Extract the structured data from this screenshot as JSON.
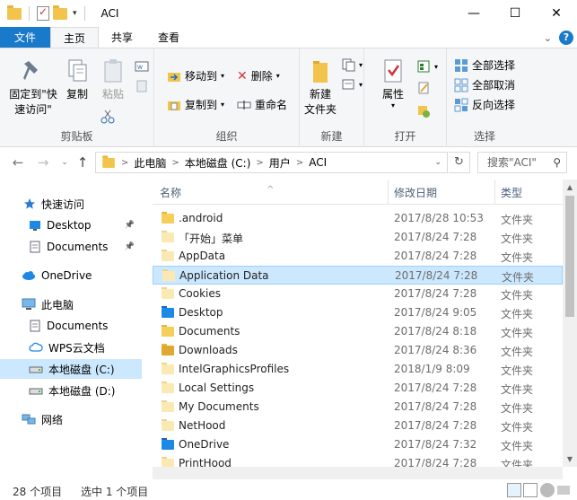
{
  "window": {
    "title": "ACI"
  },
  "ribbon_tabs": [
    "文件",
    "主页",
    "共享",
    "查看"
  ],
  "ribbon": {
    "clipboard": {
      "pin_label": "固定到\"快\n速访问\"",
      "copy_label": "复制",
      "paste_label": "粘贴",
      "group": "剪贴板"
    },
    "organize": {
      "move_to": "移动到",
      "copy_to": "复制到",
      "delete": "删除",
      "rename": "重命名",
      "group": "组织"
    },
    "new": {
      "new_folder": "新建\n文件夹",
      "group": "新建"
    },
    "open": {
      "properties": "属性",
      "group": "打开"
    },
    "select": {
      "select_all": "全部选择",
      "select_none": "全部取消",
      "invert": "反向选择",
      "group": "选择"
    }
  },
  "address": {
    "crumbs": [
      "此电脑",
      "本地磁盘 (C:)",
      "用户",
      "ACI"
    ],
    "search_placeholder": "搜索\"ACI\""
  },
  "nav_pane": [
    {
      "label": "快速访问",
      "icon": "star-icon",
      "pinned": false,
      "selected": false
    },
    {
      "label": "Desktop",
      "icon": "desktop-icon",
      "pinned": true,
      "selected": false
    },
    {
      "label": "Documents",
      "icon": "document-icon",
      "pinned": true,
      "selected": false
    },
    {
      "label": "OneDrive",
      "icon": "cloud-icon",
      "pinned": false,
      "selected": false
    },
    {
      "label": "此电脑",
      "icon": "computer-icon",
      "pinned": false,
      "selected": false
    },
    {
      "label": "Documents",
      "icon": "document-icon",
      "pinned": false,
      "selected": false
    },
    {
      "label": "WPS云文档",
      "icon": "cloud-outline-icon",
      "pinned": false,
      "selected": false
    },
    {
      "label": "本地磁盘 (C:)",
      "icon": "drive-icon",
      "pinned": false,
      "selected": true
    },
    {
      "label": "本地磁盘 (D:)",
      "icon": "drive-icon",
      "pinned": false,
      "selected": false
    },
    {
      "label": "网络",
      "icon": "network-icon",
      "pinned": false,
      "selected": false
    }
  ],
  "columns": {
    "name": "名称",
    "date": "修改日期",
    "type": "类型"
  },
  "files": [
    {
      "name": ".android",
      "date": "2017/8/28 10:53",
      "type": "文件夹",
      "icon": "folder",
      "selected": false
    },
    {
      "name": "「开始」菜单",
      "date": "2017/8/24 7:28",
      "type": "文件夹",
      "icon": "folder-light",
      "selected": false
    },
    {
      "name": "AppData",
      "date": "2017/8/24 7:28",
      "type": "文件夹",
      "icon": "folder-light",
      "selected": false
    },
    {
      "name": "Application Data",
      "date": "2017/8/24 7:28",
      "type": "文件夹",
      "icon": "folder-light",
      "selected": true
    },
    {
      "name": "Cookies",
      "date": "2017/8/24 7:28",
      "type": "文件夹",
      "icon": "folder-light",
      "selected": false
    },
    {
      "name": "Desktop",
      "date": "2017/8/24 9:05",
      "type": "文件夹",
      "icon": "folder-blue",
      "selected": false
    },
    {
      "name": "Documents",
      "date": "2017/8/24 8:18",
      "type": "文件夹",
      "icon": "folder-doc",
      "selected": false
    },
    {
      "name": "Downloads",
      "date": "2017/8/24 8:36",
      "type": "文件夹",
      "icon": "folder-dark",
      "selected": false
    },
    {
      "name": "IntelGraphicsProfiles",
      "date": "2018/1/9 8:09",
      "type": "文件夹",
      "icon": "folder-light",
      "selected": false
    },
    {
      "name": "Local Settings",
      "date": "2017/8/24 7:28",
      "type": "文件夹",
      "icon": "folder-light",
      "selected": false
    },
    {
      "name": "My Documents",
      "date": "2017/8/24 7:28",
      "type": "文件夹",
      "icon": "folder-light",
      "selected": false
    },
    {
      "name": "NetHood",
      "date": "2017/8/24 7:28",
      "type": "文件夹",
      "icon": "folder-light",
      "selected": false
    },
    {
      "name": "OneDrive",
      "date": "2017/8/24 7:32",
      "type": "文件夹",
      "icon": "folder-cloud",
      "selected": false
    },
    {
      "name": "PrintHood",
      "date": "2017/8/24 7:28",
      "type": "文件夹",
      "icon": "folder-light",
      "selected": false
    }
  ],
  "status": {
    "count": "28 个项目",
    "selected": "选中 1 个项目"
  }
}
